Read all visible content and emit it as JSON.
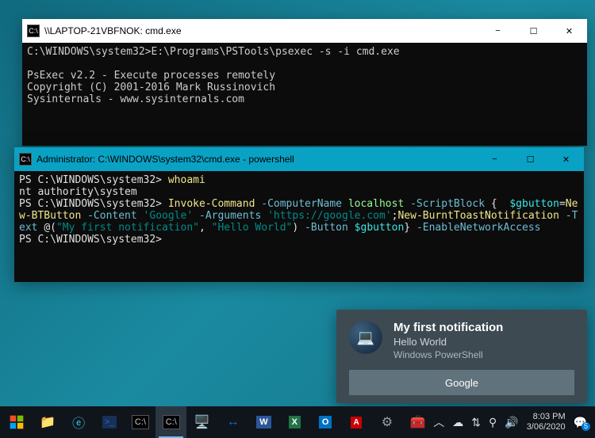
{
  "cmd_window": {
    "title": "\\\\LAPTOP-21VBFNOK: cmd.exe",
    "icon_label": "C:\\",
    "lines": {
      "l1": "C:\\WINDOWS\\system32>E:\\Programs\\PSTools\\psexec -s -i cmd.exe",
      "l2": "",
      "l3": "PsExec v2.2 - Execute processes remotely",
      "l4": "Copyright (C) 2001-2016 Mark Russinovich",
      "l5": "Sysinternals - www.sysinternals.com"
    }
  },
  "ps_window": {
    "title": "Administrator: C:\\WINDOWS\\system32\\cmd.exe - powershell",
    "icon_label": "C:\\",
    "tokens": {
      "p1": "PS C:\\WINDOWS\\system32> ",
      "whoami": "whoami",
      "resp": "nt authority\\system",
      "p2": "PS C:\\WINDOWS\\system32> ",
      "invoke": "Invoke-Command ",
      "argCN": "-ComputerName ",
      "local": "localhost ",
      "argSB": "-ScriptBlock ",
      "brace1": "{  ",
      "var1": "$gbutton",
      "eq": "=",
      "newbt": "New-BTButton ",
      "argContent": "-Content ",
      "google": "'Google' ",
      "argArgs": "-Arguments ",
      "url": "'https://google.com'",
      "semi": ";",
      "newtoast": "New-BurntToastNotification ",
      "argText": "-Text ",
      "at": "@(",
      "str1": "\"My first notification\"",
      "comma": ", ",
      "str2": "\"Hello World\"",
      "close": ") ",
      "argBtn": "-Button ",
      "var2": "$gbutton",
      "brace2": "} ",
      "argENA": "-EnableNetworkAccess",
      "p3": "PS C:\\WINDOWS\\system32>"
    }
  },
  "toast": {
    "heading": "My first notification",
    "body": "Hello World",
    "app": "Windows PowerShell",
    "button": "Google"
  },
  "tray": {
    "time": "8:03 PM",
    "date": "3/06/2020",
    "badge": "5"
  }
}
